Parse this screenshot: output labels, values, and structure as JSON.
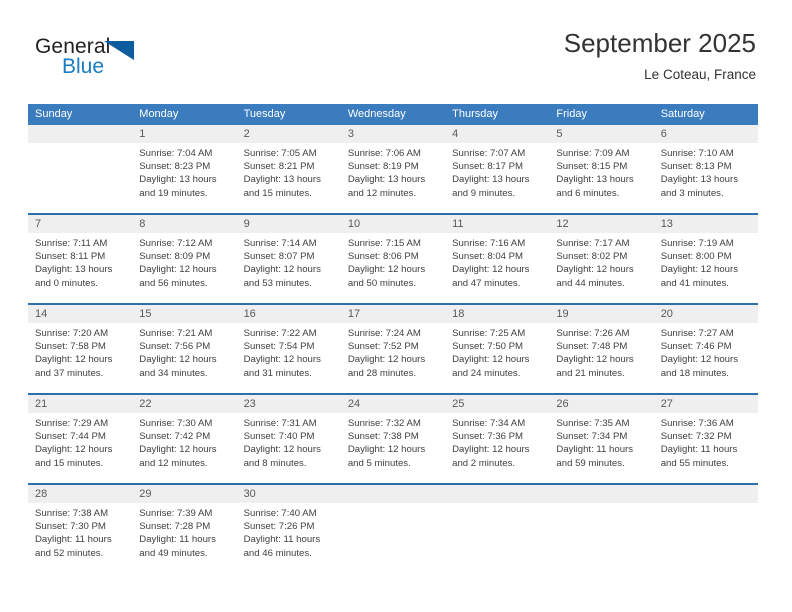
{
  "brand": {
    "name_top": "General",
    "name_bottom": "Blue",
    "accent_color": "#1a7dc4",
    "triangle_color": "#0d5c9e"
  },
  "header": {
    "month_title": "September 2025",
    "location": "Le Coteau, France"
  },
  "calendar": {
    "header_bg": "#3a7cbe",
    "daynum_bg": "#efefef",
    "rule_color": "#2f6ead",
    "weekdays": [
      "Sunday",
      "Monday",
      "Tuesday",
      "Wednesday",
      "Thursday",
      "Friday",
      "Saturday"
    ],
    "weeks": [
      [
        {
          "day": "",
          "lines": [],
          "empty": true
        },
        {
          "day": "1",
          "lines": [
            "Sunrise: 7:04 AM",
            "Sunset: 8:23 PM",
            "Daylight: 13 hours",
            "and 19 minutes."
          ]
        },
        {
          "day": "2",
          "lines": [
            "Sunrise: 7:05 AM",
            "Sunset: 8:21 PM",
            "Daylight: 13 hours",
            "and 15 minutes."
          ]
        },
        {
          "day": "3",
          "lines": [
            "Sunrise: 7:06 AM",
            "Sunset: 8:19 PM",
            "Daylight: 13 hours",
            "and 12 minutes."
          ]
        },
        {
          "day": "4",
          "lines": [
            "Sunrise: 7:07 AM",
            "Sunset: 8:17 PM",
            "Daylight: 13 hours",
            "and 9 minutes."
          ]
        },
        {
          "day": "5",
          "lines": [
            "Sunrise: 7:09 AM",
            "Sunset: 8:15 PM",
            "Daylight: 13 hours",
            "and 6 minutes."
          ]
        },
        {
          "day": "6",
          "lines": [
            "Sunrise: 7:10 AM",
            "Sunset: 8:13 PM",
            "Daylight: 13 hours",
            "and 3 minutes."
          ]
        }
      ],
      [
        {
          "day": "7",
          "lines": [
            "Sunrise: 7:11 AM",
            "Sunset: 8:11 PM",
            "Daylight: 13 hours",
            "and 0 minutes."
          ]
        },
        {
          "day": "8",
          "lines": [
            "Sunrise: 7:12 AM",
            "Sunset: 8:09 PM",
            "Daylight: 12 hours",
            "and 56 minutes."
          ]
        },
        {
          "day": "9",
          "lines": [
            "Sunrise: 7:14 AM",
            "Sunset: 8:07 PM",
            "Daylight: 12 hours",
            "and 53 minutes."
          ]
        },
        {
          "day": "10",
          "lines": [
            "Sunrise: 7:15 AM",
            "Sunset: 8:06 PM",
            "Daylight: 12 hours",
            "and 50 minutes."
          ]
        },
        {
          "day": "11",
          "lines": [
            "Sunrise: 7:16 AM",
            "Sunset: 8:04 PM",
            "Daylight: 12 hours",
            "and 47 minutes."
          ]
        },
        {
          "day": "12",
          "lines": [
            "Sunrise: 7:17 AM",
            "Sunset: 8:02 PM",
            "Daylight: 12 hours",
            "and 44 minutes."
          ]
        },
        {
          "day": "13",
          "lines": [
            "Sunrise: 7:19 AM",
            "Sunset: 8:00 PM",
            "Daylight: 12 hours",
            "and 41 minutes."
          ]
        }
      ],
      [
        {
          "day": "14",
          "lines": [
            "Sunrise: 7:20 AM",
            "Sunset: 7:58 PM",
            "Daylight: 12 hours",
            "and 37 minutes."
          ]
        },
        {
          "day": "15",
          "lines": [
            "Sunrise: 7:21 AM",
            "Sunset: 7:56 PM",
            "Daylight: 12 hours",
            "and 34 minutes."
          ]
        },
        {
          "day": "16",
          "lines": [
            "Sunrise: 7:22 AM",
            "Sunset: 7:54 PM",
            "Daylight: 12 hours",
            "and 31 minutes."
          ]
        },
        {
          "day": "17",
          "lines": [
            "Sunrise: 7:24 AM",
            "Sunset: 7:52 PM",
            "Daylight: 12 hours",
            "and 28 minutes."
          ]
        },
        {
          "day": "18",
          "lines": [
            "Sunrise: 7:25 AM",
            "Sunset: 7:50 PM",
            "Daylight: 12 hours",
            "and 24 minutes."
          ]
        },
        {
          "day": "19",
          "lines": [
            "Sunrise: 7:26 AM",
            "Sunset: 7:48 PM",
            "Daylight: 12 hours",
            "and 21 minutes."
          ]
        },
        {
          "day": "20",
          "lines": [
            "Sunrise: 7:27 AM",
            "Sunset: 7:46 PM",
            "Daylight: 12 hours",
            "and 18 minutes."
          ]
        }
      ],
      [
        {
          "day": "21",
          "lines": [
            "Sunrise: 7:29 AM",
            "Sunset: 7:44 PM",
            "Daylight: 12 hours",
            "and 15 minutes."
          ]
        },
        {
          "day": "22",
          "lines": [
            "Sunrise: 7:30 AM",
            "Sunset: 7:42 PM",
            "Daylight: 12 hours",
            "and 12 minutes."
          ]
        },
        {
          "day": "23",
          "lines": [
            "Sunrise: 7:31 AM",
            "Sunset: 7:40 PM",
            "Daylight: 12 hours",
            "and 8 minutes."
          ]
        },
        {
          "day": "24",
          "lines": [
            "Sunrise: 7:32 AM",
            "Sunset: 7:38 PM",
            "Daylight: 12 hours",
            "and 5 minutes."
          ]
        },
        {
          "day": "25",
          "lines": [
            "Sunrise: 7:34 AM",
            "Sunset: 7:36 PM",
            "Daylight: 12 hours",
            "and 2 minutes."
          ]
        },
        {
          "day": "26",
          "lines": [
            "Sunrise: 7:35 AM",
            "Sunset: 7:34 PM",
            "Daylight: 11 hours",
            "and 59 minutes."
          ]
        },
        {
          "day": "27",
          "lines": [
            "Sunrise: 7:36 AM",
            "Sunset: 7:32 PM",
            "Daylight: 11 hours",
            "and 55 minutes."
          ]
        }
      ],
      [
        {
          "day": "28",
          "lines": [
            "Sunrise: 7:38 AM",
            "Sunset: 7:30 PM",
            "Daylight: 11 hours",
            "and 52 minutes."
          ]
        },
        {
          "day": "29",
          "lines": [
            "Sunrise: 7:39 AM",
            "Sunset: 7:28 PM",
            "Daylight: 11 hours",
            "and 49 minutes."
          ]
        },
        {
          "day": "30",
          "lines": [
            "Sunrise: 7:40 AM",
            "Sunset: 7:26 PM",
            "Daylight: 11 hours",
            "and 46 minutes."
          ]
        },
        {
          "day": "",
          "lines": [],
          "empty": true
        },
        {
          "day": "",
          "lines": [],
          "empty": true
        },
        {
          "day": "",
          "lines": [],
          "empty": true
        },
        {
          "day": "",
          "lines": [],
          "empty": true
        }
      ]
    ]
  }
}
